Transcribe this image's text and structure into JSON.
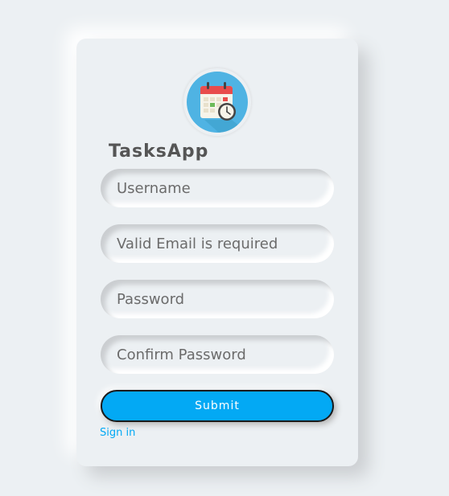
{
  "app": {
    "title": "TasksApp",
    "logo_icon": "calendar-clock-icon"
  },
  "form": {
    "username_placeholder": "Username",
    "email_placeholder": "Valid Email is required",
    "password_placeholder": "Password",
    "confirm_password_placeholder": "Confirm Password",
    "submit_label": "Submit",
    "signin_link": "Sign in"
  },
  "colors": {
    "background": "#ecf0f3",
    "accent": "#03a9f4",
    "title_text": "#555555",
    "logo_circle": "#4fb3e3"
  }
}
